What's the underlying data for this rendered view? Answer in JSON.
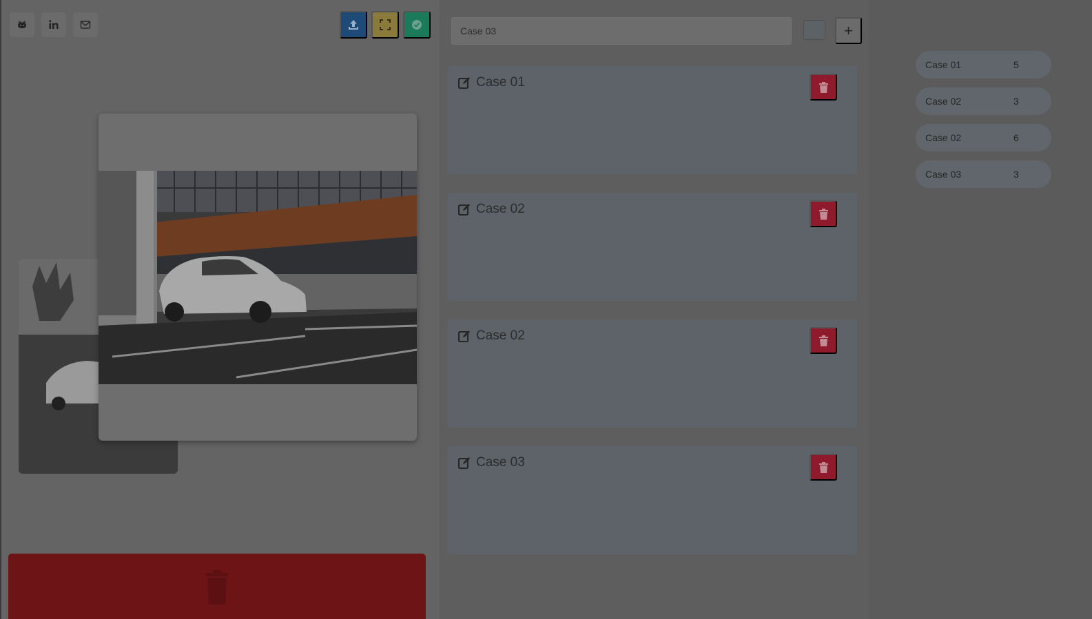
{
  "social": {
    "icons": [
      "github-icon",
      "linkedin-icon",
      "mail-icon"
    ]
  },
  "toolbar": {
    "buttons": [
      {
        "icon": "upload-icon",
        "color": "#1e4a78"
      },
      {
        "icon": "fullscreen-icon",
        "color": "#8a7a3c"
      },
      {
        "icon": "check-circle-icon",
        "color": "#1a7a5a"
      }
    ]
  },
  "case_input": {
    "value": "Case 03",
    "color_value": "#5d6266"
  },
  "add_button": {
    "label": "+"
  },
  "cases": [
    {
      "title": "Case 01"
    },
    {
      "title": "Case 02"
    },
    {
      "title": "Case 02"
    },
    {
      "title": "Case 03"
    }
  ],
  "case_counts": [
    {
      "label": "Case 01",
      "count": "5"
    },
    {
      "label": "Case 02",
      "count": "3"
    },
    {
      "label": "Case 02",
      "count": "6"
    },
    {
      "label": "Case 03",
      "count": "3"
    }
  ],
  "colors": {
    "delete": "#8f1a2c",
    "trash_zone": "#6d1416",
    "overlay": "#5f5f5f"
  }
}
